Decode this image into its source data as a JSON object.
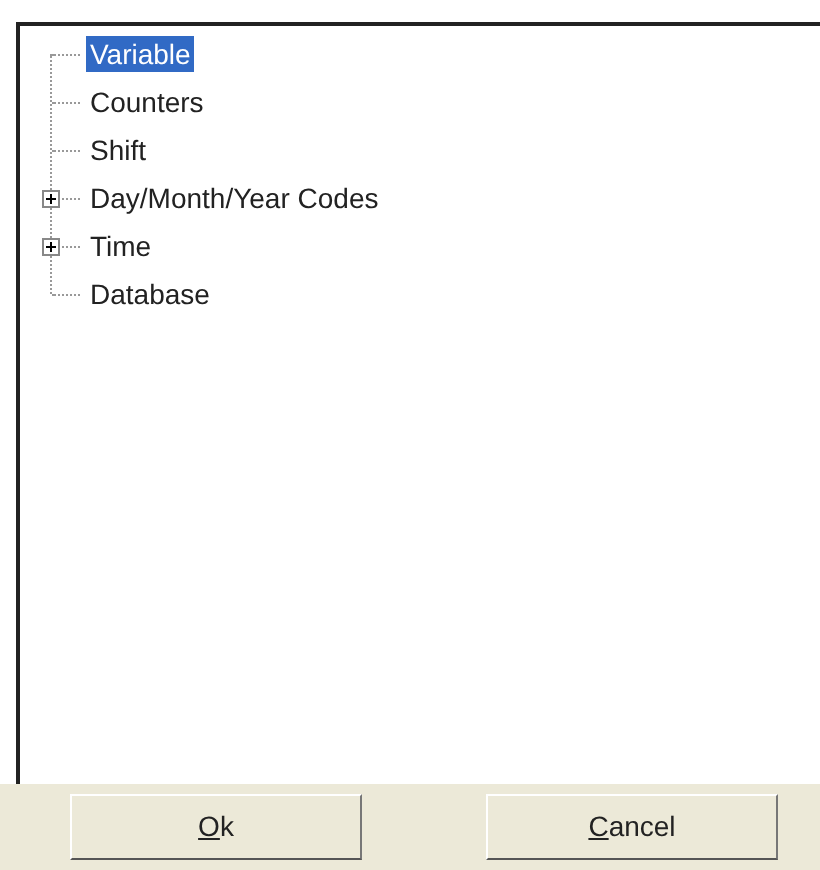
{
  "tree": {
    "items": [
      {
        "label": "Variable",
        "kind": "leaf",
        "selected": true
      },
      {
        "label": "Counters",
        "kind": "leaf",
        "selected": false
      },
      {
        "label": "Shift",
        "kind": "leaf",
        "selected": false
      },
      {
        "label": "Day/Month/Year Codes",
        "kind": "collapsed",
        "selected": false
      },
      {
        "label": "Time",
        "kind": "collapsed",
        "selected": false
      },
      {
        "label": "Database",
        "kind": "leaf",
        "selected": false
      }
    ]
  },
  "buttons": [
    {
      "access_key": "O",
      "label_rest": "k"
    },
    {
      "access_key": "C",
      "label_rest": "ancel"
    }
  ]
}
